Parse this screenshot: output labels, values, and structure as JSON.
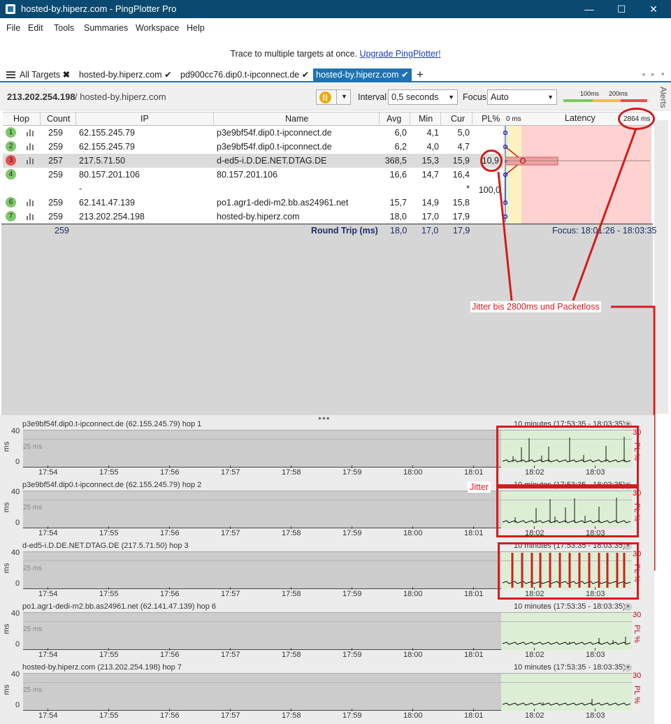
{
  "window": {
    "title": "hosted-by.hiperz.com - PingPlotter Pro",
    "minimize": "—",
    "maximize": "☐",
    "close": "✕"
  },
  "menu": [
    "File",
    "Edit",
    "Tools",
    "Summaries",
    "Workspace",
    "Help"
  ],
  "banner": {
    "text": "Trace to multiple targets at once.",
    "link": "Upgrade PingPlotter!"
  },
  "tabs": [
    "All Targets",
    "hosted-by.hiperz.com",
    "pd900cc76.dip0.t-ipconnect.de",
    "hosted-by.hiperz.com"
  ],
  "toolbar": {
    "ip": "213.202.254.198",
    "host": "/ hosted-by.hiperz.com",
    "interval_label": "Interval",
    "interval_value": "0,5 seconds",
    "focus_label": "Focus",
    "focus_value": "Auto",
    "legend_100": "100ms",
    "legend_200": "200ms"
  },
  "alerts_label": "Alerts",
  "table": {
    "headers": {
      "hop": "Hop",
      "count": "Count",
      "ip": "IP",
      "name": "Name",
      "avg": "Avg",
      "min": "Min",
      "cur": "Cur",
      "pl": "PL%",
      "zero": "0 ms",
      "latency": "Latency",
      "max": "2864 ms"
    },
    "rows": [
      {
        "hop": "1",
        "count": "259",
        "ip": "62.155.245.79",
        "name": "p3e9bf54f.dip0.t-ipconnect.de",
        "avg": "6,0",
        "min": "4,1",
        "cur": "5,0",
        "pl": "",
        "color": "#7ec86a"
      },
      {
        "hop": "2",
        "count": "259",
        "ip": "62.155.245.79",
        "name": "p3e9bf54f.dip0.t-ipconnect.de",
        "avg": "6,2",
        "min": "4,0",
        "cur": "4,7",
        "pl": "",
        "color": "#7ec86a"
      },
      {
        "hop": "3",
        "count": "257",
        "ip": "217.5.71.50",
        "name": "d-ed5-i.D.DE.NET.DTAG.DE",
        "avg": "368,5",
        "min": "15,3",
        "cur": "15,9",
        "pl": "10,9",
        "color": "#e8514d"
      },
      {
        "hop": "4",
        "count": "259",
        "ip": "80.157.201.106",
        "name": "80.157.201.106",
        "avg": "16,6",
        "min": "14,7",
        "cur": "16,4",
        "pl": "",
        "color": "#7ec86a"
      },
      {
        "hop": "",
        "count": "",
        "ip": "-",
        "name": "",
        "avg": "",
        "min": "",
        "cur": "*",
        "pl": "100,0",
        "color": ""
      },
      {
        "hop": "6",
        "count": "259",
        "ip": "62.141.47.139",
        "name": "po1.agr1-dedi-m2.bb.as24961.net",
        "avg": "15,7",
        "min": "14,9",
        "cur": "15,8",
        "pl": "",
        "color": "#7ec86a"
      },
      {
        "hop": "7",
        "count": "259",
        "ip": "213.202.254.198",
        "name": "hosted-by.hiperz.com",
        "avg": "18,0",
        "min": "17,0",
        "cur": "17,9",
        "pl": "",
        "color": "#7ec86a"
      }
    ],
    "summary": {
      "count": "259",
      "label": "Round Trip (ms)",
      "avg": "18,0",
      "min": "17,0",
      "cur": "17,9",
      "focus": "Focus: 18:01:26 - 18:03:35"
    }
  },
  "annotations": {
    "jitter_loss": "Jitter bis 2800ms und Packetloss",
    "jitter": "Jitter"
  },
  "graphs": {
    "range": "10 minutes (17:53:35 - 18:03:35)",
    "y_max": "40",
    "y_mid": "25 ms",
    "y_min": "0",
    "y_unit": "ms",
    "pl_max": "30",
    "pl_unit": "PL %",
    "xticks": [
      "17:54",
      "17:55",
      "17:56",
      "17:57",
      "17:58",
      "17:59",
      "18:00",
      "18:01",
      "18:02",
      "18:03"
    ],
    "panels": [
      {
        "title": "p3e9bf54f.dip0.t-ipconnect.de (62.155.245.79) hop 1"
      },
      {
        "title": "p3e9bf54f.dip0.t-ipconnect.de (62.155.245.79) hop 2"
      },
      {
        "title": "d-ed5-i.D.DE.NET.DTAG.DE (217.5.71.50) hop 3"
      },
      {
        "title": "po1.agr1-dedi-m2.bb.as24961.net (62.141.47.139) hop 6"
      },
      {
        "title": "hosted-by.hiperz.com (213.202.254.198) hop 7"
      }
    ]
  }
}
